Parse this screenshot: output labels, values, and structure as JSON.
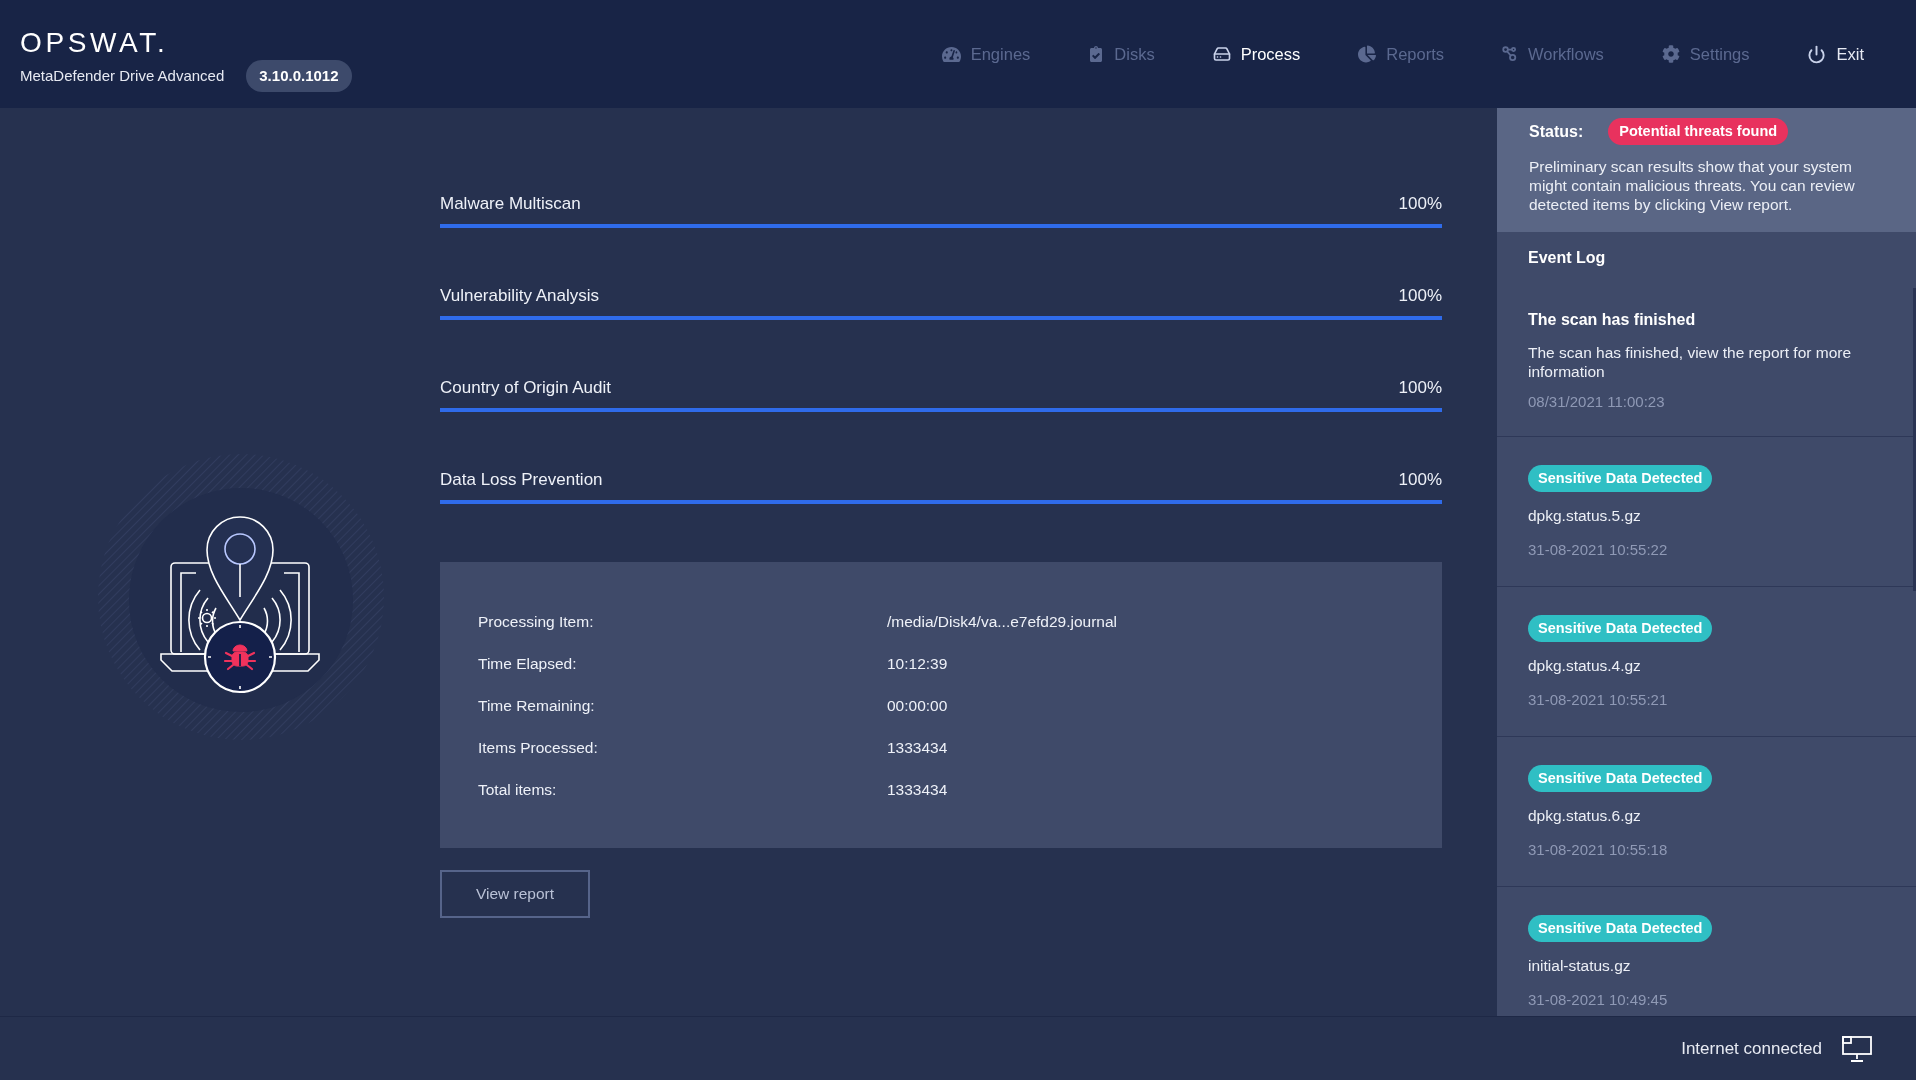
{
  "header": {
    "logo": "OPSWAT.",
    "product": "MetaDefender Drive Advanced",
    "version": "3.10.0.1012"
  },
  "nav": {
    "tabs": [
      {
        "label": "Engines",
        "selected": false
      },
      {
        "label": "Disks",
        "selected": false
      },
      {
        "label": "Process",
        "selected": true
      },
      {
        "label": "Reports",
        "selected": false
      },
      {
        "label": "Workflows",
        "selected": false
      },
      {
        "label": "Settings",
        "selected": false
      }
    ],
    "exit": "Exit"
  },
  "scans": [
    {
      "label": "Malware Multiscan",
      "percent": "100%",
      "level": 1
    },
    {
      "label": "Vulnerability Analysis",
      "percent": "100%",
      "level": 1
    },
    {
      "label": "Country of Origin Audit",
      "percent": "100%",
      "level": 1
    },
    {
      "label": "Data Loss Prevention",
      "percent": "100%",
      "level": 1
    }
  ],
  "details": [
    {
      "label": "Processing Item:",
      "value": "/media/Disk4/va...e7efd29.journal"
    },
    {
      "label": "Time Elapsed:",
      "value": "10:12:39"
    },
    {
      "label": "Time Remaining:",
      "value": "00:00:00"
    },
    {
      "label": "Items Processed:",
      "value": "1333434"
    },
    {
      "label": "Total items:",
      "value": "1333434"
    }
  ],
  "view_report_button": "View report",
  "status_panel": {
    "label": "Status:",
    "badge": "Potential threats found",
    "description": "Preliminary scan results show that your system might contain malicious threats. You can review detected items by clicking View report."
  },
  "event_log": {
    "title": "Event Log",
    "events": [
      {
        "kind": "message",
        "title": "The scan has finished",
        "description": "The scan has finished, view the report for more information",
        "time": "08/31/2021 11:00:23"
      },
      {
        "kind": "detection",
        "badge": "Sensitive Data Detected",
        "file": "dpkg.status.5.gz",
        "time": "31-08-2021 10:55:22"
      },
      {
        "kind": "detection",
        "badge": "Sensitive Data Detected",
        "file": "dpkg.status.4.gz",
        "time": "31-08-2021 10:55:21"
      },
      {
        "kind": "detection",
        "badge": "Sensitive Data Detected",
        "file": "dpkg.status.6.gz",
        "time": "31-08-2021 10:55:18"
      },
      {
        "kind": "detection",
        "badge": "Sensitive Data Detected",
        "file": "initial-status.gz",
        "time": "31-08-2021 10:49:45"
      }
    ]
  },
  "status_bar": {
    "connection": "Internet connected"
  }
}
